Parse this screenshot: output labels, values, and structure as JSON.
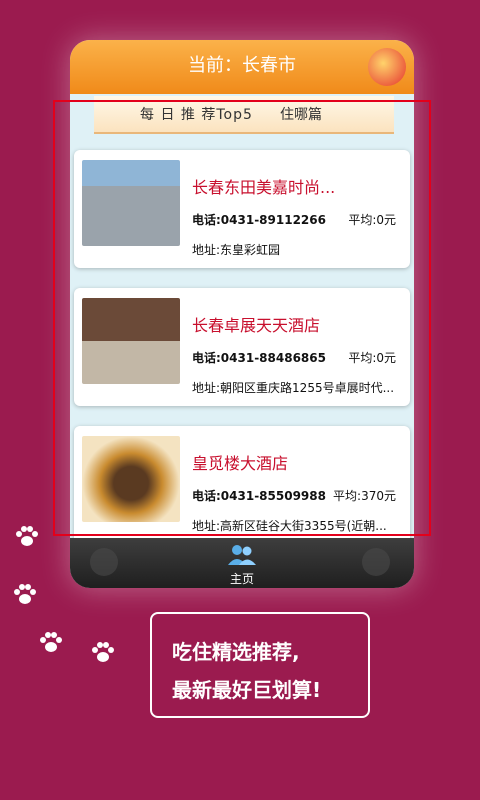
{
  "header": {
    "title": "当前：长春市"
  },
  "tabs": [
    {
      "label": "每 日 推 荐Top5"
    },
    {
      "label": "住哪篇"
    }
  ],
  "hotels": [
    {
      "name": "长春东田美嘉时尚...",
      "phone": "电话:0431-89112266",
      "avg": "平均:0元",
      "address": "地址:东皇彩虹园"
    },
    {
      "name": "长春卓展天天酒店",
      "phone": "电话:0431-88486865",
      "avg": "平均:0元",
      "address": "地址:朝阳区重庆路1255号卓展时代..."
    },
    {
      "name": "皇觅楼大酒店",
      "phone": "电话:0431-85509988",
      "avg": "平均:370元",
      "address": "地址:高新区硅谷大街3355号(近朝..."
    }
  ],
  "bottom_nav": {
    "home_label": "主页"
  },
  "promo": {
    "line1": "吃住精选推荐,",
    "line2": "最新最好巨划算!"
  },
  "colors": {
    "background": "#9b1b4f",
    "accent": "#f08a19",
    "name_red": "#c8102e",
    "frame_red": "#e3001b"
  }
}
